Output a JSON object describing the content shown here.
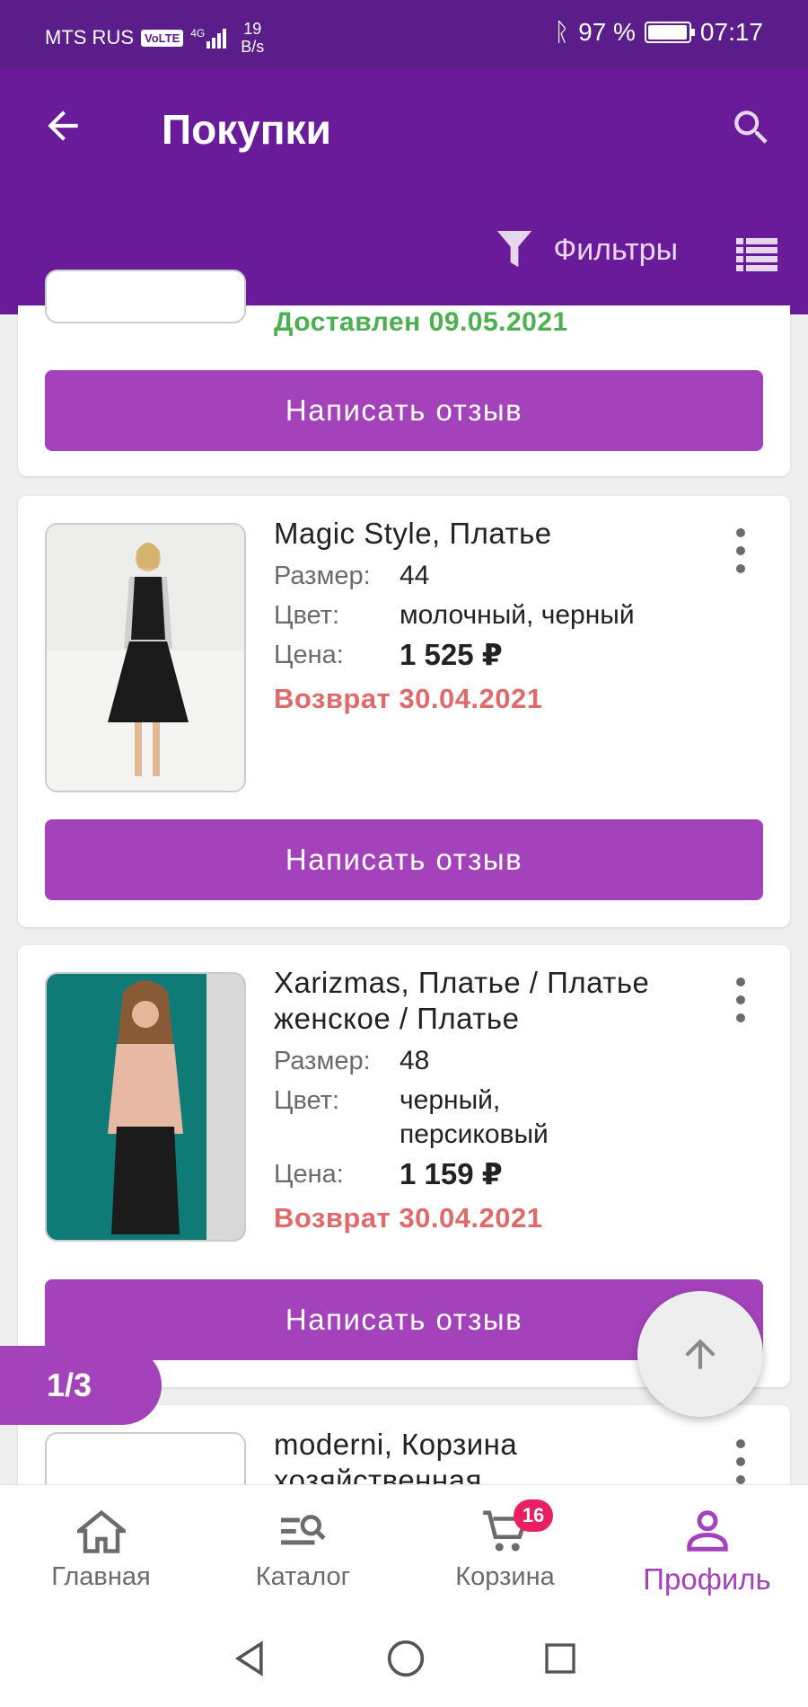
{
  "status_bar": {
    "carrier": "MTS RUS",
    "volte": "VoLTE",
    "network": "4G",
    "speed_value": "19",
    "speed_unit": "B/s",
    "battery": "97 %",
    "time": "07:17"
  },
  "app_bar": {
    "title": "Покупки",
    "filters_label": "Фильтры"
  },
  "orders": [
    {
      "status": "Доставлен 09.05.2021",
      "review_label": "Написать отзыв"
    },
    {
      "name": "Magic Style, Платье",
      "size_label": "Размер:",
      "size": "44",
      "color_label": "Цвет:",
      "color": "молочный, черный",
      "price_label": "Цена:",
      "price": "1 525 ₽",
      "status": "Возврат 30.04.2021",
      "review_label": "Написать отзыв"
    },
    {
      "name": "Xarizmas, Платье / Платье женское / Платье",
      "size_label": "Размер:",
      "size": "48",
      "color_label": "Цвет:",
      "color": "черный, персиковый",
      "price_label": "Цена:",
      "price": "1 159 ₽",
      "status": "Возврат 30.04.2021",
      "review_label": "Написать отзыв"
    },
    {
      "name": "moderni, Корзина хозяйственная"
    }
  ],
  "pagination": "1/3",
  "bottom_nav": {
    "items": [
      {
        "label": "Главная",
        "icon": "home-icon"
      },
      {
        "label": "Каталог",
        "icon": "catalog-icon"
      },
      {
        "label": "Корзина",
        "icon": "cart-icon",
        "badge": "16"
      },
      {
        "label": "Профиль",
        "icon": "profile-icon",
        "active": true
      }
    ]
  },
  "colors": {
    "status_bar": "#5a1d8a",
    "app_bar": "#6a1b9a",
    "accent": "#a442bb",
    "delivered": "#4caf50",
    "returned": "#e06a6a",
    "badge": "#e91e63"
  }
}
